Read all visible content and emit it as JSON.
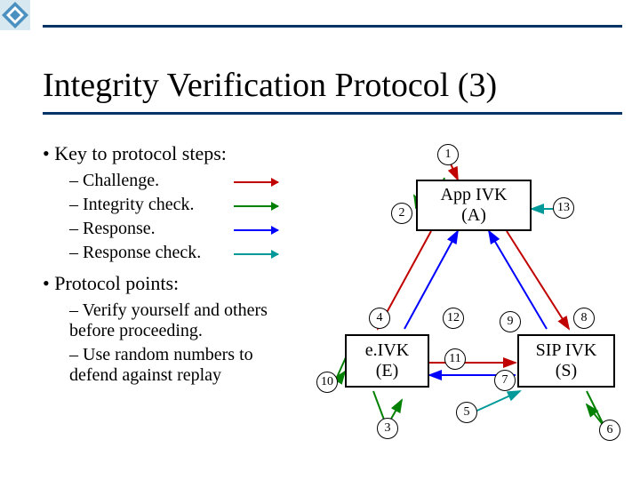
{
  "title": "Integrity Verification Protocol (3)",
  "bullets": {
    "heading1": "Key to protocol steps:",
    "items1": [
      {
        "label": "Challenge."
      },
      {
        "label": "Integrity check."
      },
      {
        "label": "Response."
      },
      {
        "label": "Response check."
      }
    ],
    "heading2": "Protocol points:",
    "items2": [
      {
        "label": "Verify yourself and others before proceeding."
      },
      {
        "label": "Use random numbers to defend against replay"
      }
    ]
  },
  "diagram": {
    "boxA": {
      "line1": "App IVK",
      "line2": "(A)"
    },
    "boxE": {
      "line1": "e.IVK",
      "line2": "(E)"
    },
    "boxS": {
      "line1": "SIP IVK",
      "line2": "(S)"
    }
  },
  "circles": {
    "n1": "1",
    "n2": "2",
    "n3": "3",
    "n4": "4",
    "n5": "5",
    "n6": "6",
    "n7": "7",
    "n8": "8",
    "n9": "9",
    "n10": "10",
    "n11": "11",
    "n12": "12",
    "n13": "13"
  }
}
